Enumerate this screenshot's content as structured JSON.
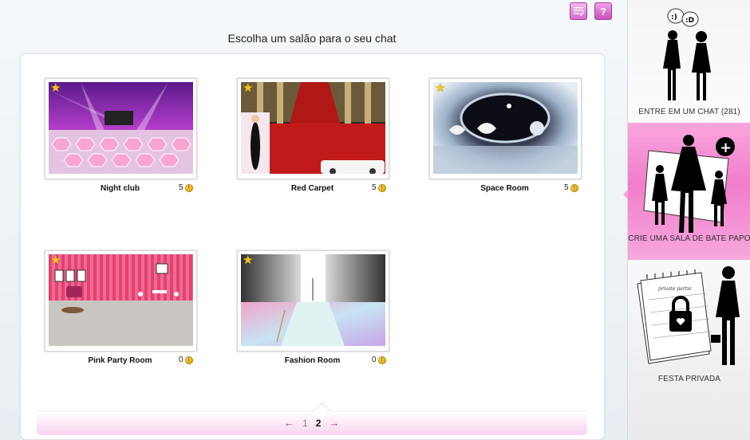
{
  "toolbar": {
    "list_icon": "list-check-icon",
    "help_icon": "help-icon",
    "help_glyph": "?"
  },
  "title": "Escolha um salão para o seu chat",
  "rooms": [
    {
      "name": "Night club",
      "count": "5",
      "favorite": true
    },
    {
      "name": "Red Carpet",
      "count": "5",
      "favorite": true
    },
    {
      "name": "Space Room",
      "count": "5",
      "favorite": true
    },
    {
      "name": "Pink Party Room",
      "count": "0",
      "favorite": true
    },
    {
      "name": "Fashion Room",
      "count": "0",
      "favorite": true
    }
  ],
  "pager": {
    "prev": "←",
    "pages": [
      "1",
      "2"
    ],
    "current": "2",
    "next": "→"
  },
  "sidebar": {
    "items": [
      {
        "label": "ENTRE EM UM CHAT (281)",
        "bubble1": ":)",
        "bubble2": ":D"
      },
      {
        "label": "CRIE UMA SALA DE BATE PAPO",
        "plus": "+"
      },
      {
        "label": "FESTA PRIVADA",
        "calendar_text": "private partie"
      }
    ]
  },
  "colors": {
    "accent": "#b02a9c",
    "sidebar_active": "#f27dcb",
    "coin": "#e0a800"
  }
}
